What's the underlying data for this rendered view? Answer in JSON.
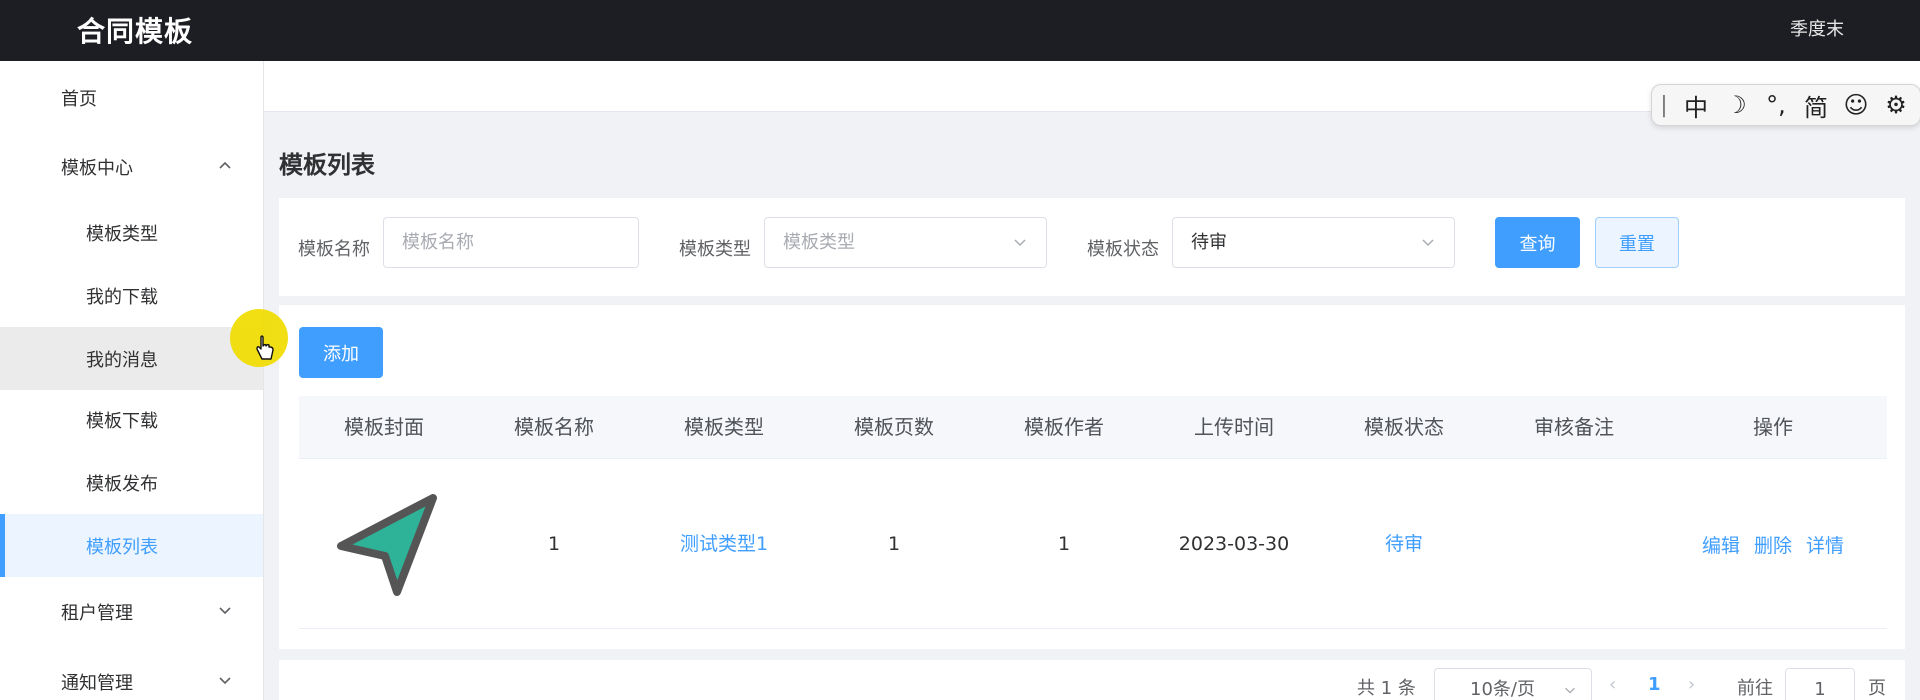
{
  "header": {
    "app_title": "合同模板",
    "user_name": "季度末"
  },
  "sidebar": {
    "items": [
      {
        "label": "首页",
        "level": 1
      },
      {
        "label": "模板中心",
        "level": 1,
        "expanded": true,
        "icon": "chevron-up-icon"
      },
      {
        "label": "模板类型",
        "level": 2
      },
      {
        "label": "我的下载",
        "level": 2
      },
      {
        "label": "我的消息",
        "level": 2,
        "hovered": true
      },
      {
        "label": "模板下载",
        "level": 2
      },
      {
        "label": "模板发布",
        "level": 2
      },
      {
        "label": "模板列表",
        "level": 2,
        "active": true
      },
      {
        "label": "租户管理",
        "level": 1,
        "icon": "chevron-down-icon"
      },
      {
        "label": "通知管理",
        "level": 1,
        "icon": "chevron-down-icon"
      }
    ]
  },
  "page": {
    "title": "模板列表"
  },
  "filters": {
    "name_label": "模板名称",
    "name_placeholder": "模板名称",
    "type_label": "模板类型",
    "type_placeholder": "模板类型",
    "status_label": "模板状态",
    "status_value": "待审",
    "query_button": "查询",
    "reset_button": "重置"
  },
  "actions": {
    "add_button": "添加"
  },
  "table": {
    "columns": [
      "模板封面",
      "模板名称",
      "模板类型",
      "模板页数",
      "模板作者",
      "上传时间",
      "模板状态",
      "审核备注",
      "操作"
    ],
    "rows": [
      {
        "cover_icon": "paper-plane-icon",
        "name": "1",
        "type": "测试类型1",
        "pages": "1",
        "author": "1",
        "upload_time": "2023-03-30",
        "status": "待审",
        "remark": "",
        "ops": [
          "编辑",
          "删除",
          "详情"
        ]
      }
    ]
  },
  "pagination": {
    "total_text": "共 1 条",
    "page_size": "10条/页",
    "current_page": "1",
    "goto_label": "前往",
    "goto_value": "1",
    "page_suffix": "页"
  },
  "ime_toolbar": {
    "items": [
      "中",
      "☽",
      "°,",
      "简",
      "☺",
      "⚙"
    ]
  },
  "colors": {
    "primary": "#409eff",
    "header_bg": "#1d1e23",
    "active_bg": "#ecf5ff"
  }
}
